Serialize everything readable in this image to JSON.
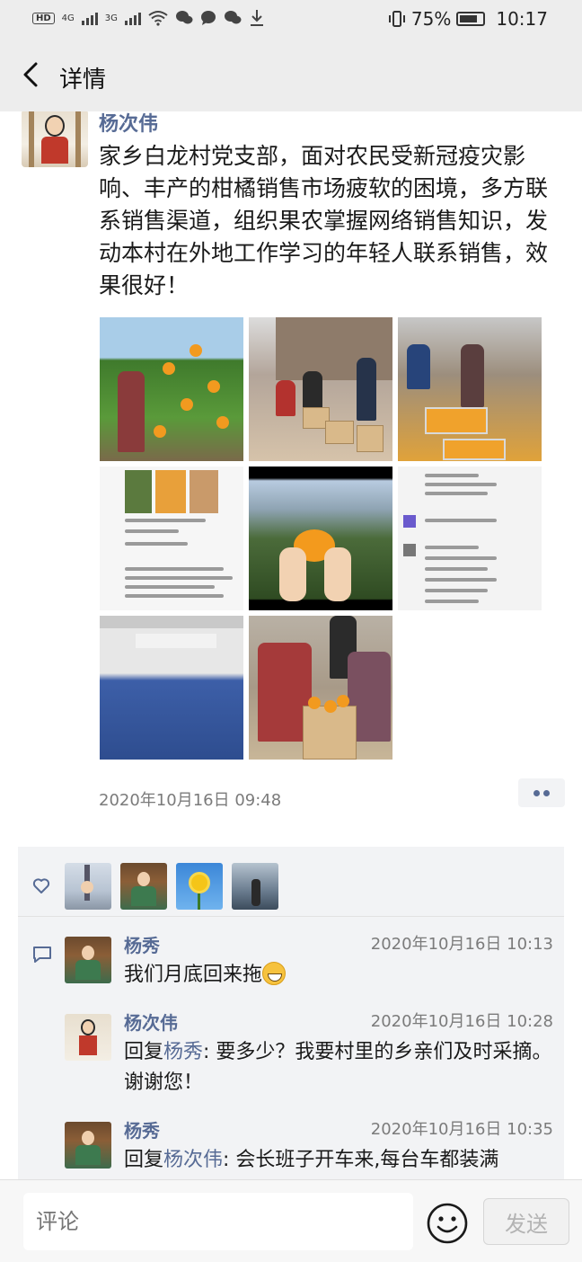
{
  "status_bar": {
    "hd": "HD",
    "net1": "4G",
    "net2": "3G",
    "battery_pct": "75%",
    "time": "10:17"
  },
  "nav": {
    "title": "详情",
    "back_icon": "chevron-left-icon"
  },
  "post": {
    "author": "杨次伟",
    "text": "家乡白龙村党支部，面对农民受新冠疫灾影响、丰产的柑橘销售市场疲软的困境，多方联系销售渠道，组织果农掌握网络销售知识，发动本村在外地工作学习的年轻人联系销售，效果很好！",
    "images_count": 8,
    "timestamp": "2020年10月16日 09:48",
    "more_icon": "more-dots-icon"
  },
  "likes": {
    "icon": "heart-icon",
    "avatars": [
      "avatar-1",
      "avatar-2",
      "avatar-3",
      "avatar-4"
    ]
  },
  "comments": {
    "icon": "comment-icon",
    "items": [
      {
        "name": "杨秀",
        "time": "2020年10月16日 10:13",
        "text": "我们月底回来拖",
        "emoji": "grin-emoji"
      },
      {
        "name": "杨次伟",
        "time": "2020年10月16日 10:28",
        "reply_prefix": "回复",
        "reply_to": "杨秀",
        "text": ": 要多少？我要村里的乡亲们及时采摘。谢谢您！"
      },
      {
        "name": "杨秀",
        "time": "2020年10月16日 10:35",
        "reply_prefix": "回复",
        "reply_to": "杨次伟",
        "text": ": 会长班子开车来,每台车都装满"
      }
    ]
  },
  "input": {
    "placeholder": "评论",
    "send_label": "发送",
    "emoji_icon": "smile-icon"
  }
}
